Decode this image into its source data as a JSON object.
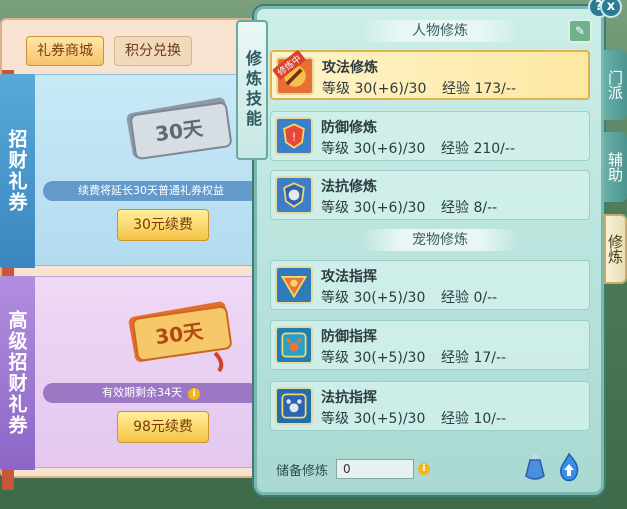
{
  "shop": {
    "tabs": [
      "礼券商城",
      "积分兑换"
    ],
    "cards": [
      {
        "side_label": "招财礼券",
        "ticket_text": "30天",
        "info": "续费将延长30天普通礼券权益",
        "button": "30元续费"
      },
      {
        "side_label": "高级招财礼券",
        "ticket_text": "30天",
        "info": "有效期剩余34天",
        "button": "98元续费"
      }
    ],
    "info_icon": "i"
  },
  "panel": {
    "vertical_title": "修炼技能",
    "right_tabs": [
      "门派",
      "辅助",
      "修炼"
    ],
    "section_person": "人物修炼",
    "section_pet": "宠物修炼",
    "help_icon": "?",
    "close_icon": "x",
    "skills": [
      {
        "name": "攻法修炼",
        "level": "等级 30(+6)/30",
        "exp": "经验 173/--",
        "badge": "修炼中"
      },
      {
        "name": "防御修炼",
        "level": "等级 30(+6)/30",
        "exp": "经验 210/--"
      },
      {
        "name": "法抗修炼",
        "level": "等级 30(+6)/30",
        "exp": "经验 8/--"
      },
      {
        "name": "攻法指挥",
        "level": "等级 30(+5)/30",
        "exp": "经验 0/--"
      },
      {
        "name": "防御指挥",
        "level": "等级 30(+5)/30",
        "exp": "经验 17/--"
      },
      {
        "name": "法抗指挥",
        "level": "等级 30(+5)/30",
        "exp": "经验 10/--"
      }
    ],
    "storage_label": "储备修炼",
    "storage_value": "0"
  }
}
